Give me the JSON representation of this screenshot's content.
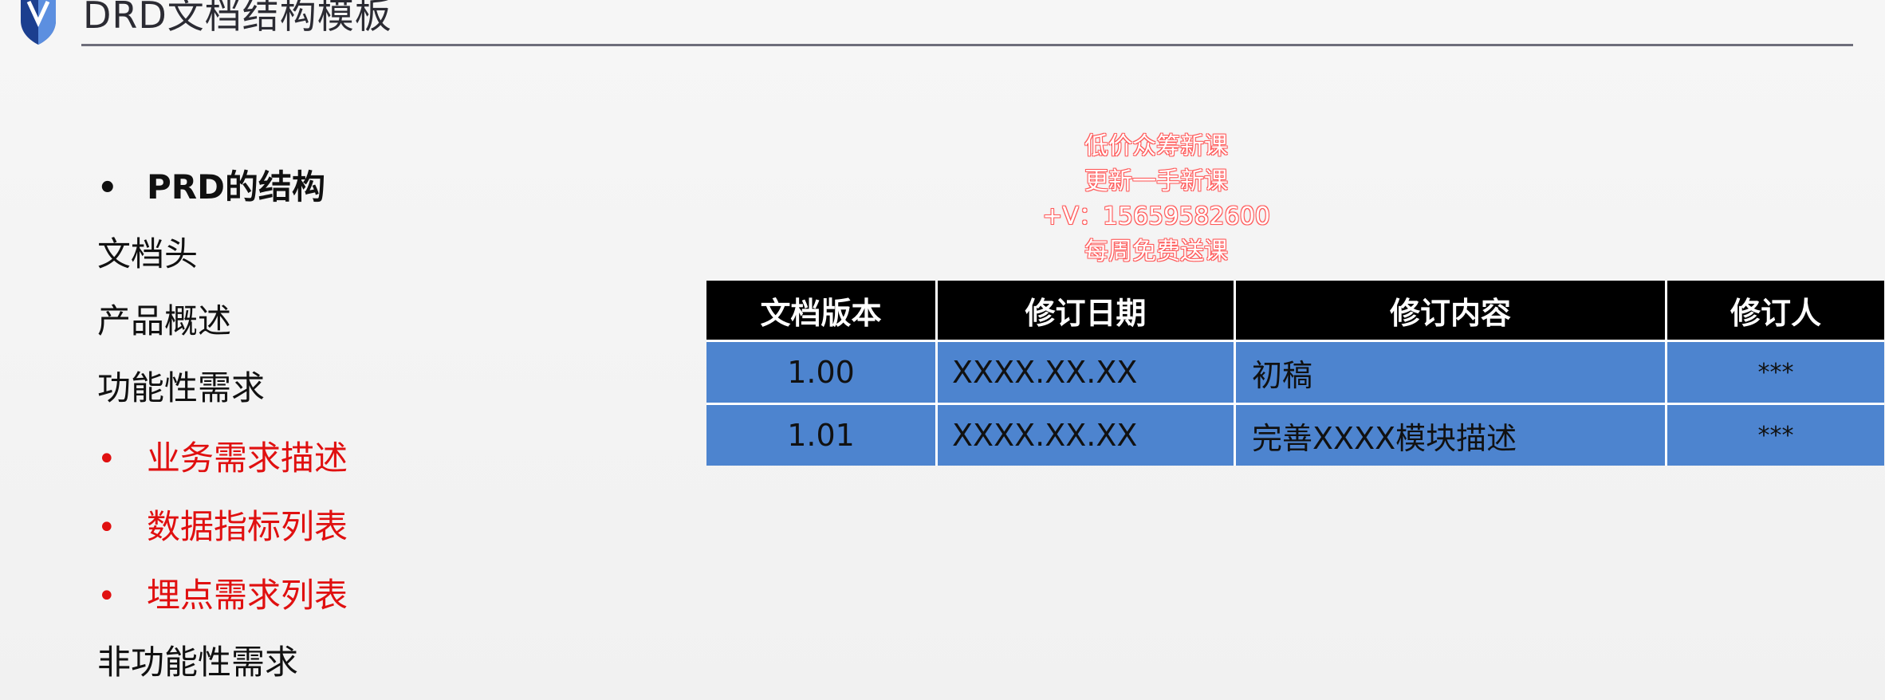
{
  "header": {
    "title": "DRD文档结构模板"
  },
  "outline": {
    "items": [
      {
        "text": "PRD的结构",
        "bullet": "•",
        "style": "heading"
      },
      {
        "text": "文档头",
        "bullet": "",
        "style": "plain"
      },
      {
        "text": "产品概述",
        "bullet": "",
        "style": "plain"
      },
      {
        "text": "功能性需求",
        "bullet": "",
        "style": "plain"
      },
      {
        "text": "业务需求描述",
        "bullet": "•",
        "style": "red"
      },
      {
        "text": "数据指标列表",
        "bullet": "•",
        "style": "red"
      },
      {
        "text": "埋点需求列表",
        "bullet": "•",
        "style": "red"
      },
      {
        "text": "非功能性需求",
        "bullet": "",
        "style": "plain"
      }
    ]
  },
  "watermark": {
    "lines": [
      "低价众筹新课",
      "更新一手新课",
      "+V：15659582600",
      "每周免费送课"
    ]
  },
  "revision_table": {
    "headers": [
      "文档版本",
      "修订日期",
      "修订内容",
      "修订人"
    ],
    "rows": [
      [
        "1.00",
        "XXXX.XX.XX",
        "初稿",
        "***"
      ],
      [
        "1.01",
        "XXXX.XX.XX",
        "完善XXXX模块描述",
        "***"
      ]
    ]
  },
  "colors": {
    "accent_red": "#e01010",
    "table_header_bg": "#000000",
    "table_row_bg": "#4d84cf",
    "logo_blue": "#1c3f8f"
  }
}
